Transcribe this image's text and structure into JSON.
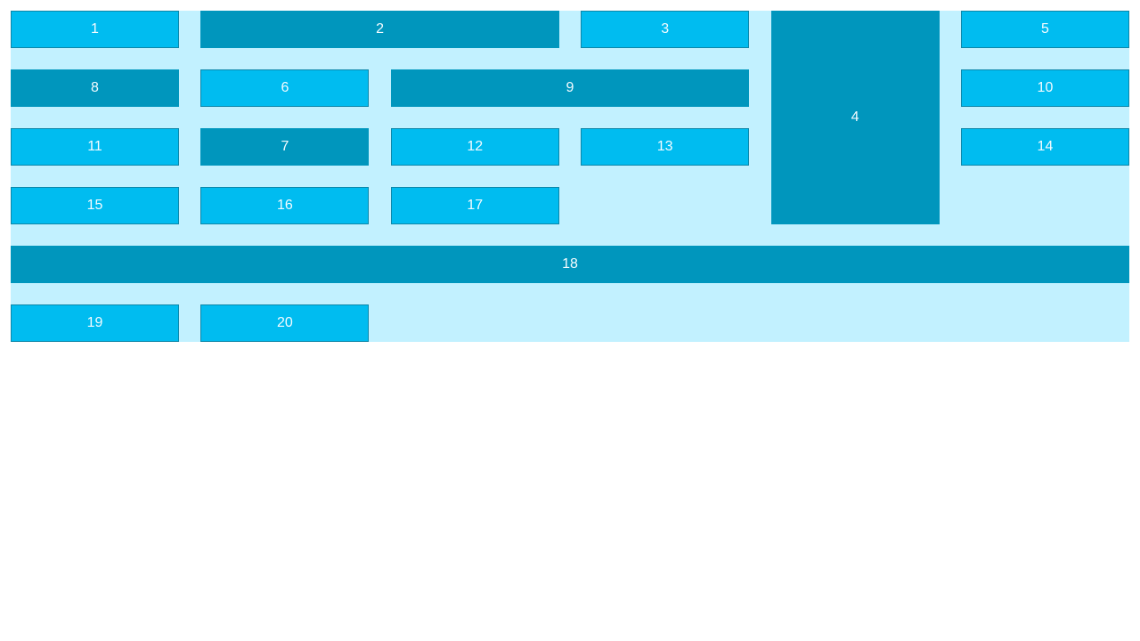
{
  "colors": {
    "container_background": "#c2f1ff",
    "light_item": "#00bcf0",
    "dark_item": "#0096bd",
    "item_text": "#f3fbff"
  },
  "items": [
    {
      "label": "1",
      "tone": "light"
    },
    {
      "label": "2",
      "tone": "dark"
    },
    {
      "label": "3",
      "tone": "light"
    },
    {
      "label": "4",
      "tone": "dark"
    },
    {
      "label": "5",
      "tone": "light"
    },
    {
      "label": "6",
      "tone": "light"
    },
    {
      "label": "7",
      "tone": "dark"
    },
    {
      "label": "8",
      "tone": "dark"
    },
    {
      "label": "9",
      "tone": "dark"
    },
    {
      "label": "10",
      "tone": "light"
    },
    {
      "label": "11",
      "tone": "light"
    },
    {
      "label": "12",
      "tone": "light"
    },
    {
      "label": "13",
      "tone": "light"
    },
    {
      "label": "14",
      "tone": "light"
    },
    {
      "label": "15",
      "tone": "light"
    },
    {
      "label": "16",
      "tone": "light"
    },
    {
      "label": "17",
      "tone": "light"
    },
    {
      "label": "18",
      "tone": "dark"
    },
    {
      "label": "19",
      "tone": "light"
    },
    {
      "label": "20",
      "tone": "light"
    }
  ]
}
